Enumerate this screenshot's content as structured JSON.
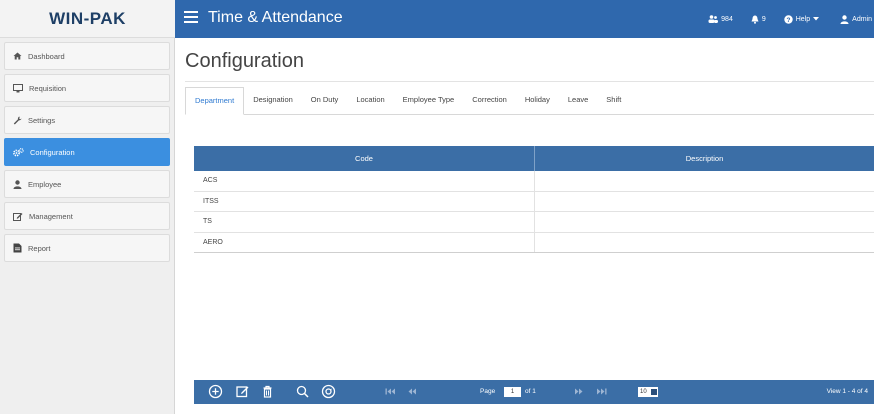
{
  "brand": "WIN-PAK",
  "app_title": "Time & Attendance",
  "top_actions": {
    "users_count": "984",
    "alerts_count": "9",
    "help_label": "Help",
    "user_label": "Admin"
  },
  "sidebar": {
    "items": [
      {
        "label": "Dashboard",
        "icon": "home-icon"
      },
      {
        "label": "Requisition",
        "icon": "monitor-icon"
      },
      {
        "label": "Settings",
        "icon": "wrench-icon"
      },
      {
        "label": "Configuration",
        "icon": "cogs-icon",
        "active": true
      },
      {
        "label": "Employee",
        "icon": "user-icon"
      },
      {
        "label": "Management",
        "icon": "edit-icon"
      },
      {
        "label": "Report",
        "icon": "report-icon"
      }
    ]
  },
  "page_title": "Configuration",
  "tabs": [
    "Department",
    "Designation",
    "On Duty",
    "Location",
    "Employee Type",
    "Correction",
    "Holiday",
    "Leave",
    "Shift"
  ],
  "active_tab": "Department",
  "grid": {
    "columns": [
      "Code",
      "Description"
    ],
    "rows": [
      [
        "ACS",
        ""
      ],
      [
        "ITSS",
        ""
      ],
      [
        "TS",
        ""
      ],
      [
        "AERO",
        ""
      ]
    ]
  },
  "pager": {
    "page_label": "Page",
    "page_value": "1",
    "of_label": "of 1",
    "rows_per_page": "10",
    "view_label": "View 1 - 4 of 4"
  },
  "colors": {
    "topbar": "#2f68ad",
    "active_sidebar": "#3b8fe0",
    "grid_header": "#3b6ea6"
  }
}
